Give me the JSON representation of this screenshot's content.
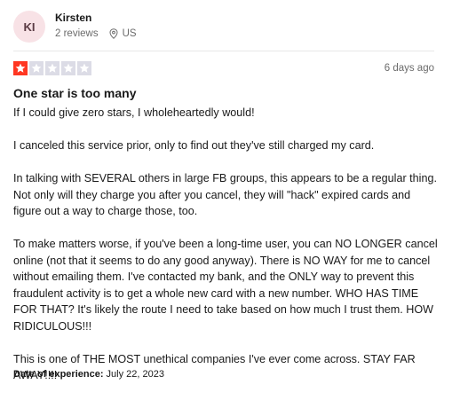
{
  "reviewer": {
    "initials": "KI",
    "name": "Kirsten",
    "review_count": "2 reviews",
    "country": "US"
  },
  "rating": {
    "stars": 1,
    "max_stars": 5,
    "filled_color": "#ff3722",
    "empty_color": "#dcdce6",
    "icon": "star-icon"
  },
  "review": {
    "date": "6 days ago",
    "title": "One star is too many",
    "paragraphs": [
      "If I could give zero stars, I wholeheartedly would!",
      "I canceled this service prior, only to find out they've still charged my card.",
      "In talking with SEVERAL others in large FB groups, this appears to be a regular thing. Not only will they charge you after you cancel, they will \"hack\" expired cards and figure out a way to charge those, too.",
      "To make matters worse, if you've been a long-time user, you can NO LONGER cancel online (not that it seems to do any good anyway). There is NO WAY for me to cancel without emailing them. I've contacted my bank, and the ONLY way to prevent this fraudulent activity is to get a whole new card with a new number. WHO HAS TIME FOR THAT? It's likely the route I need to take based on how much I trust them. HOW RIDICULOUS!!!",
      "This is one of THE MOST unethical companies I've ever come across. STAY FAR AWAY!!!!"
    ],
    "experience_label": "Date of experience:",
    "experience_date": "July 22, 2023"
  },
  "icons": {
    "location": "location-pin-icon"
  }
}
